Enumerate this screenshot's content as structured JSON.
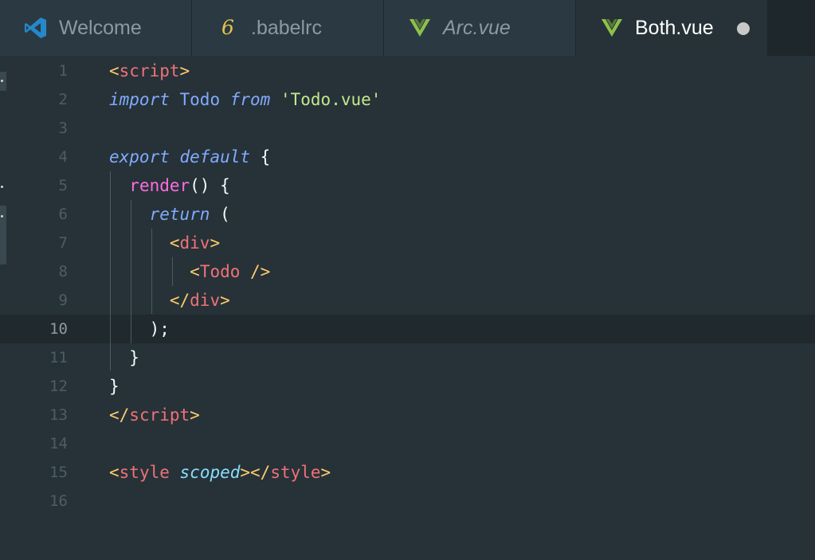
{
  "tabs": [
    {
      "label": "Welcome",
      "icon": "vscode-logo-icon",
      "active": false
    },
    {
      "label": ".babelrc",
      "icon": "babel-icon",
      "glyph": "6",
      "active": false
    },
    {
      "label": "Arc.vue",
      "icon": "vue-icon",
      "active": false
    },
    {
      "label": "Both.vue",
      "icon": "vue-icon",
      "active": true,
      "dirty": true
    }
  ],
  "editor": {
    "current_line": 10,
    "lines": [
      {
        "n": "1",
        "tokens": [
          {
            "t": "<",
            "c": "tok-brk"
          },
          {
            "t": "script",
            "c": "tok-tag"
          },
          {
            "t": ">",
            "c": "tok-brk"
          }
        ]
      },
      {
        "n": "2",
        "tokens": [
          {
            "t": "import",
            "c": "tok-kw2"
          },
          {
            "t": " ",
            "c": "tok-plain"
          },
          {
            "t": "Todo",
            "c": "tok-id"
          },
          {
            "t": " ",
            "c": "tok-plain"
          },
          {
            "t": "from",
            "c": "tok-kw2"
          },
          {
            "t": " ",
            "c": "tok-plain"
          },
          {
            "t": "'Todo.vue'",
            "c": "tok-str"
          }
        ]
      },
      {
        "n": "3",
        "tokens": []
      },
      {
        "n": "4",
        "tokens": [
          {
            "t": "export",
            "c": "tok-kw2"
          },
          {
            "t": " ",
            "c": "tok-plain"
          },
          {
            "t": "default",
            "c": "tok-kw2"
          },
          {
            "t": " {",
            "c": "tok-plain"
          }
        ]
      },
      {
        "n": "5",
        "tokens": [
          {
            "t": "  ",
            "c": "tok-plain"
          },
          {
            "t": "render",
            "c": "tok-fn"
          },
          {
            "t": "() {",
            "c": "tok-plain"
          }
        ]
      },
      {
        "n": "6",
        "tokens": [
          {
            "t": "    ",
            "c": "tok-plain"
          },
          {
            "t": "return",
            "c": "tok-kw2"
          },
          {
            "t": " (",
            "c": "tok-plain"
          }
        ]
      },
      {
        "n": "7",
        "tokens": [
          {
            "t": "      ",
            "c": "tok-plain"
          },
          {
            "t": "<",
            "c": "tok-brk"
          },
          {
            "t": "div",
            "c": "tok-tag"
          },
          {
            "t": ">",
            "c": "tok-brk"
          }
        ]
      },
      {
        "n": "8",
        "tokens": [
          {
            "t": "        ",
            "c": "tok-plain"
          },
          {
            "t": "<",
            "c": "tok-brk"
          },
          {
            "t": "Todo",
            "c": "tok-tag"
          },
          {
            "t": " />",
            "c": "tok-brk"
          }
        ]
      },
      {
        "n": "9",
        "tokens": [
          {
            "t": "      ",
            "c": "tok-plain"
          },
          {
            "t": "</",
            "c": "tok-brk"
          },
          {
            "t": "div",
            "c": "tok-tag"
          },
          {
            "t": ">",
            "c": "tok-brk"
          }
        ]
      },
      {
        "n": "10",
        "tokens": [
          {
            "t": "    );",
            "c": "tok-plain"
          }
        ]
      },
      {
        "n": "11",
        "tokens": [
          {
            "t": "  }",
            "c": "tok-plain"
          }
        ]
      },
      {
        "n": "12",
        "tokens": [
          {
            "t": "}",
            "c": "tok-plain"
          }
        ]
      },
      {
        "n": "13",
        "tokens": [
          {
            "t": "</",
            "c": "tok-brk"
          },
          {
            "t": "script",
            "c": "tok-tag"
          },
          {
            "t": ">",
            "c": "tok-brk"
          }
        ]
      },
      {
        "n": "14",
        "tokens": []
      },
      {
        "n": "15",
        "tokens": [
          {
            "t": "<",
            "c": "tok-brk"
          },
          {
            "t": "style",
            "c": "tok-tag"
          },
          {
            "t": " ",
            "c": "tok-plain"
          },
          {
            "t": "scoped",
            "c": "tok-attr"
          },
          {
            "t": "></",
            "c": "tok-brk"
          },
          {
            "t": "style",
            "c": "tok-tag"
          },
          {
            "t": ">",
            "c": "tok-brk"
          }
        ]
      },
      {
        "n": "16",
        "tokens": []
      }
    ]
  },
  "colors": {
    "background": "#263238",
    "tabbar": "#1e272c",
    "tab_inactive": "#2b3a42",
    "vue_green": "#8dc149",
    "vscode_blue": "#2489ca",
    "babel_yellow": "#e5c34a"
  }
}
